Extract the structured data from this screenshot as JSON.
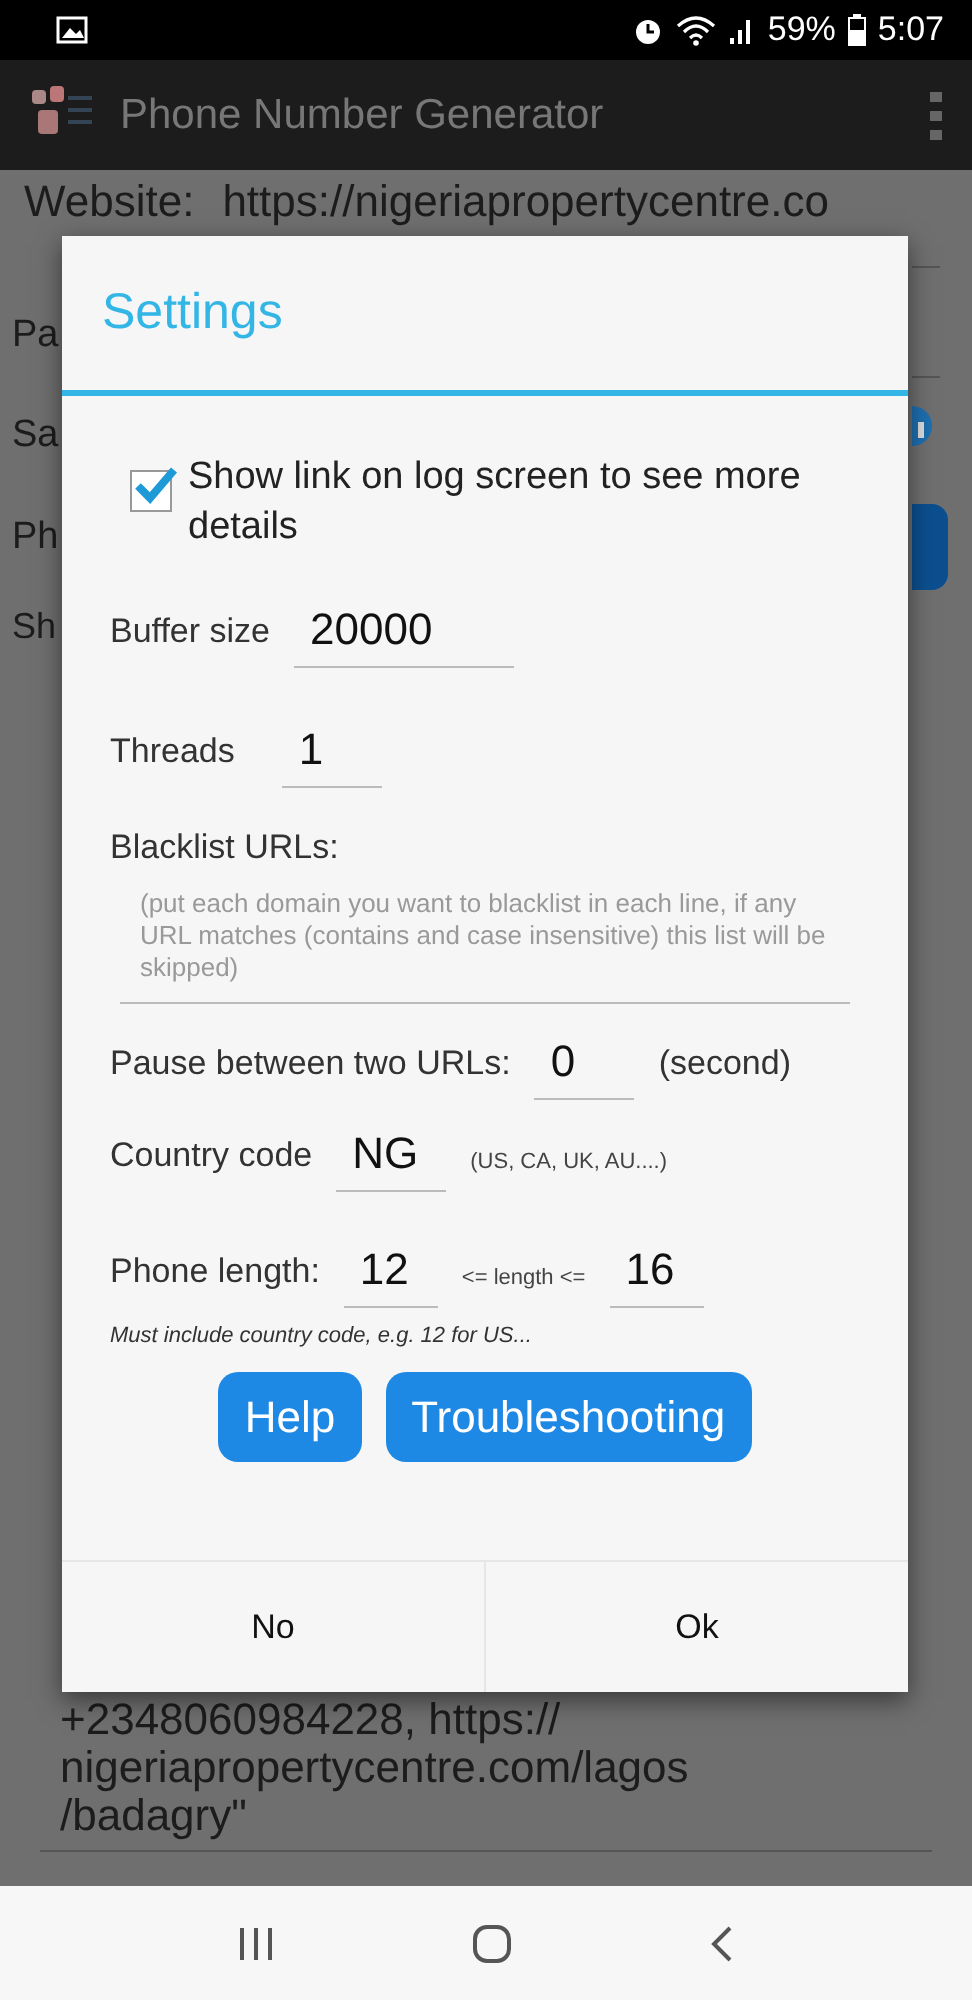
{
  "status_bar": {
    "battery": "59%",
    "time": "5:07"
  },
  "app_bar": {
    "title": "Phone Number Generator"
  },
  "background": {
    "website_label": "Website:",
    "website_value": "https://nigeriapropertycentre.co",
    "labels": [
      "Pa",
      "Sa",
      "Ph",
      "Sh"
    ],
    "log_lines": [
      "+2348060984228, https://",
      "nigeriapropertycentre.com/lagos",
      "/badagry\""
    ]
  },
  "dialog": {
    "title": "Settings",
    "show_link": {
      "label": "Show link on log screen to see more details",
      "checked": true
    },
    "buffer_size": {
      "label": "Buffer size",
      "value": "20000"
    },
    "threads": {
      "label": "Threads",
      "value": "1"
    },
    "blacklist": {
      "label": "Blacklist URLs:",
      "placeholder": "(put each domain you want to blacklist in each line, if any URL matches (contains and case insensitive) this list will be skipped)"
    },
    "pause": {
      "label": "Pause between two URLs:",
      "value": "0",
      "unit": "(second)"
    },
    "country_code": {
      "label": "Country code",
      "value": "NG",
      "hint": "(US, CA, UK, AU....)"
    },
    "phone_length": {
      "label": "Phone length:",
      "min": "12",
      "between": "<= length <=",
      "max": "16",
      "note": "Must include country code, e.g. 12 for US..."
    },
    "buttons": [
      "Help",
      "Troubleshooting"
    ],
    "actions": [
      "No",
      "Ok"
    ]
  }
}
